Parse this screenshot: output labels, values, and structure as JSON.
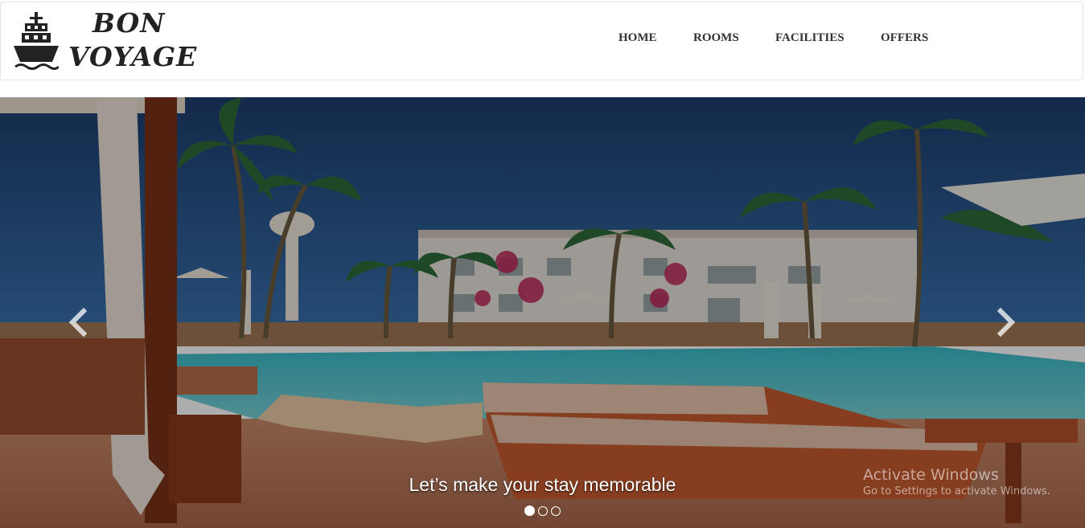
{
  "brand": {
    "line1": "BON",
    "line2": "VOYAGE",
    "icon": "ship-icon"
  },
  "nav": {
    "items": [
      {
        "label": "HOME"
      },
      {
        "label": "ROOMS"
      },
      {
        "label": "FACILITIES"
      },
      {
        "label": "OFFERS"
      }
    ]
  },
  "carousel": {
    "caption": "Let’s make your stay memorable",
    "prev_icon": "chevron-left-icon",
    "next_icon": "chevron-right-icon",
    "slide_count": 3,
    "active_slide": 1
  },
  "os_watermark": {
    "title": "Activate Windows",
    "subtitle": "Go to Settings to activate Windows."
  },
  "colors": {
    "nav_text": "#333333",
    "brand_text": "#222222",
    "border": "#e3e3e3"
  }
}
